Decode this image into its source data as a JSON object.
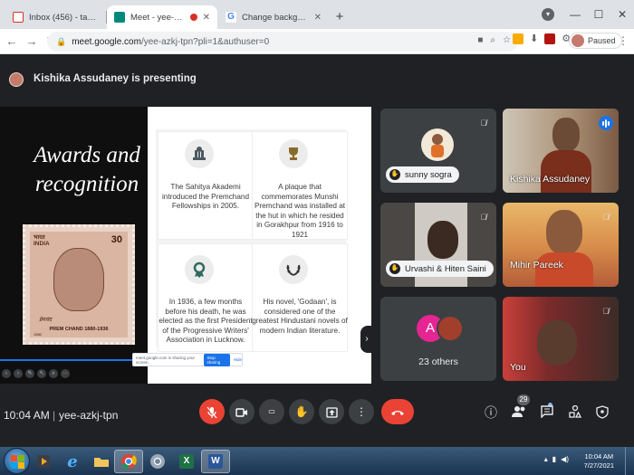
{
  "browser": {
    "tabs": [
      {
        "label": "Inbox (456) - tarannum@theindi...",
        "favicon": "gmail",
        "active": false
      },
      {
        "label": "Meet - yee-azkj-tpn",
        "favicon": "meet",
        "active": true,
        "recording": true
      },
      {
        "label": "Change background and use effe...",
        "favicon": "google",
        "active": false
      }
    ],
    "url_host": "meet.google.com",
    "url_path": "/yee-azkj-tpn?pli=1&authuser=0",
    "profile_status": "Paused"
  },
  "banner": {
    "presenting_text": "Kishika Assudaney is presenting"
  },
  "slide": {
    "title": "Awards and recognition",
    "stamp": {
      "country_hindi": "भारत",
      "country": "INDIA",
      "value": "30",
      "caption": "PREM CHAND 1880-1936",
      "signature": "प्रेमचंद",
      "year": "1980"
    },
    "facts": [
      {
        "icon": "chess-pieces-icon",
        "text": "The Sahitya Akademi introduced the Premchand Fellowships in 2005."
      },
      {
        "icon": "trophy-icon",
        "text": "A plaque that commemorates Munshi Premchand was installed at the hut in which he resided in Gorakhpur from 1916 to 1921"
      },
      {
        "icon": "award-ribbon-icon",
        "text": "In 1936, a few months before his death, he was elected as the first President of the Progressive Writers' Association in Lucknow."
      },
      {
        "icon": "laurel-wreath-icon",
        "text": "His novel, 'Godaan', is considered one of the greatest Hindustani novels of modern Indian literature."
      }
    ],
    "share_notice": {
      "text": "meet.google.com is sharing your screen.",
      "stop_label": "Stop sharing",
      "hide_label": "Hide"
    }
  },
  "participants": [
    {
      "name": "sunny sogra",
      "style": "pill",
      "mic": "muted"
    },
    {
      "name": "Kishika Assudaney",
      "style": "plain",
      "mic": "speaking"
    },
    {
      "name": "Urvashi & Hiten Saini",
      "style": "pill",
      "mic": "muted"
    },
    {
      "name": "Mihir Pareek",
      "style": "plain",
      "mic": "muted"
    },
    {
      "name": "23 others",
      "style": "others",
      "initial": "A"
    },
    {
      "name": "You",
      "style": "plain",
      "mic": "muted"
    }
  ],
  "meeting": {
    "time": "10:04 AM",
    "separator": "|",
    "code": "yee-azkj-tpn",
    "people_count": "29"
  },
  "taskbar": {
    "time": "10:04 AM",
    "date": "7/27/2021"
  },
  "colors": {
    "meet_bg": "#202124",
    "tile_bg": "#3c4043",
    "hangup_red": "#ea4335",
    "accent_blue": "#1a73e8",
    "active_border": "#8ab4f8"
  }
}
